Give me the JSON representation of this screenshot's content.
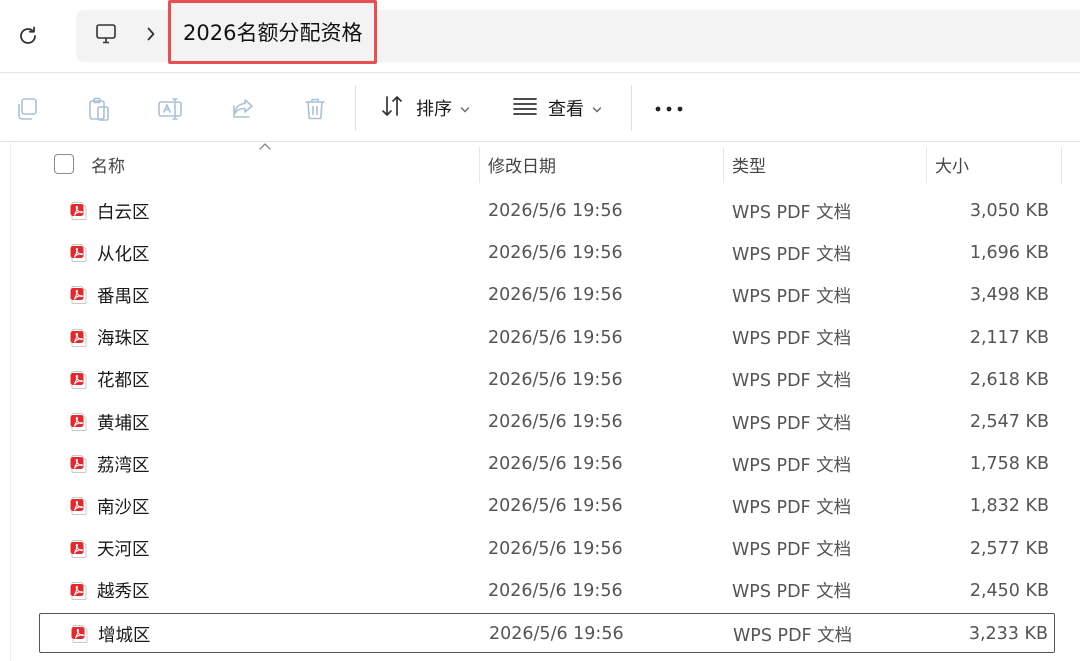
{
  "window": {
    "breadcrumb_current": "2026名额分配资格",
    "icons": {
      "refresh": "refresh-icon",
      "this_pc": "computer-icon",
      "separator": "chevron-right-icon"
    }
  },
  "command_bar": {
    "icons": [
      "copy-icon",
      "paste-icon",
      "rename-icon",
      "share-icon",
      "delete-icon"
    ],
    "sort_label": "排序",
    "view_label": "查看",
    "more": "more-icon"
  },
  "columns": {
    "name": "名称",
    "modified": "修改日期",
    "type": "类型",
    "size": "大小"
  },
  "accent_color": "#e94f50",
  "files": [
    {
      "name": "白云区",
      "modified": "2026/5/6 19:56",
      "type": "WPS PDF 文档",
      "size": "3,050 KB"
    },
    {
      "name": "从化区",
      "modified": "2026/5/6 19:56",
      "type": "WPS PDF 文档",
      "size": "1,696 KB"
    },
    {
      "name": "番禺区",
      "modified": "2026/5/6 19:56",
      "type": "WPS PDF 文档",
      "size": "3,498 KB"
    },
    {
      "name": "海珠区",
      "modified": "2026/5/6 19:56",
      "type": "WPS PDF 文档",
      "size": "2,117 KB"
    },
    {
      "name": "花都区",
      "modified": "2026/5/6 19:56",
      "type": "WPS PDF 文档",
      "size": "2,618 KB"
    },
    {
      "name": "黄埔区",
      "modified": "2026/5/6 19:56",
      "type": "WPS PDF 文档",
      "size": "2,547 KB"
    },
    {
      "name": "荔湾区",
      "modified": "2026/5/6 19:56",
      "type": "WPS PDF 文档",
      "size": "1,758 KB"
    },
    {
      "name": "南沙区",
      "modified": "2026/5/6 19:56",
      "type": "WPS PDF 文档",
      "size": "1,832 KB"
    },
    {
      "name": "天河区",
      "modified": "2026/5/6 19:56",
      "type": "WPS PDF 文档",
      "size": "2,577 KB"
    },
    {
      "name": "越秀区",
      "modified": "2026/5/6 19:56",
      "type": "WPS PDF 文档",
      "size": "2,450 KB"
    },
    {
      "name": "增城区",
      "modified": "2026/5/6 19:56",
      "type": "WPS PDF 文档",
      "size": "3,233 KB",
      "selected": true
    }
  ]
}
